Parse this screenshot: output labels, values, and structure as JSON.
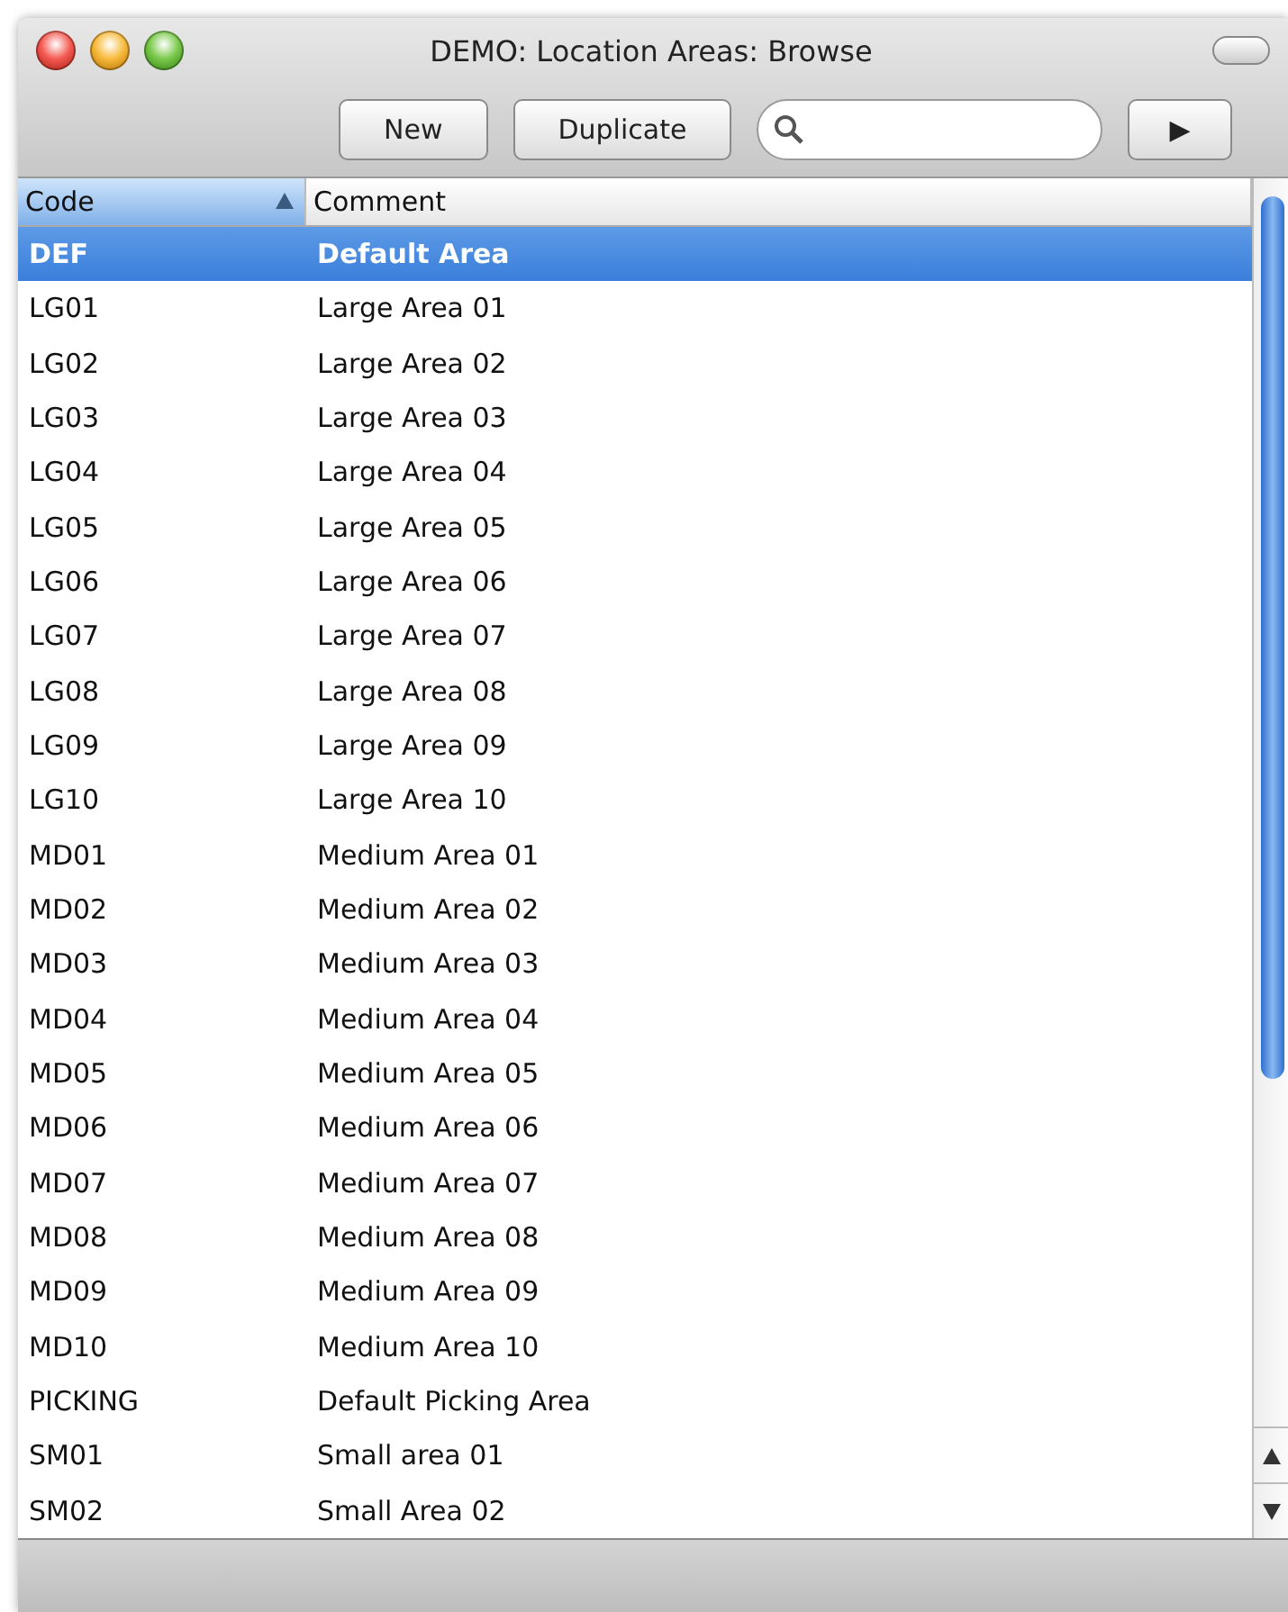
{
  "window": {
    "title": "DEMO: Location Areas: Browse"
  },
  "toolbar": {
    "buttons": [
      {
        "label": "New"
      },
      {
        "label": "Duplicate"
      }
    ],
    "next_button": {
      "label": "▶"
    }
  },
  "table": {
    "columns": [
      {
        "label": "Code",
        "sorted": true
      },
      {
        "label": "Comment",
        "sorted": false
      }
    ],
    "rows": [
      {
        "code": "DEF",
        "comment": "Default Area",
        "selected": true
      },
      {
        "code": "LG01",
        "comment": "Large Area 01",
        "selected": false
      },
      {
        "code": "LG02",
        "comment": "Large Area 02",
        "selected": false
      },
      {
        "code": "LG03",
        "comment": "Large Area 03",
        "selected": false
      },
      {
        "code": "LG04",
        "comment": "Large Area 04",
        "selected": false
      },
      {
        "code": "LG05",
        "comment": "Large Area 05",
        "selected": false
      },
      {
        "code": "LG06",
        "comment": "Large Area 06",
        "selected": false
      },
      {
        "code": "LG07",
        "comment": "Large Area 07",
        "selected": false
      },
      {
        "code": "LG08",
        "comment": "Large Area 08",
        "selected": false
      },
      {
        "code": "LG09",
        "comment": "Large Area 09",
        "selected": false
      },
      {
        "code": "LG10",
        "comment": "Large Area 10",
        "selected": false
      },
      {
        "code": "MD01",
        "comment": "Medium Area 01",
        "selected": false
      },
      {
        "code": "MD02",
        "comment": "Medium Area 02",
        "selected": false
      },
      {
        "code": "MD03",
        "comment": "Medium Area 03",
        "selected": false
      },
      {
        "code": "MD04",
        "comment": "Medium Area 04",
        "selected": false
      },
      {
        "code": "MD05",
        "comment": "Medium Area 05",
        "selected": false
      },
      {
        "code": "MD06",
        "comment": "Medium Area 06",
        "selected": false
      },
      {
        "code": "MD07",
        "comment": "Medium Area 07",
        "selected": false
      },
      {
        "code": "MD08",
        "comment": "Medium Area 08",
        "selected": false
      },
      {
        "code": "MD09",
        "comment": "Medium Area 09",
        "selected": false
      },
      {
        "code": "MD10",
        "comment": "Medium Area 10",
        "selected": false
      },
      {
        "code": "PICKING",
        "comment": "Default Picking Area",
        "selected": false
      },
      {
        "code": "SM01",
        "comment": "Small area 01",
        "selected": false
      },
      {
        "code": "SM02",
        "comment": "Small Area 02",
        "selected": false
      }
    ]
  }
}
